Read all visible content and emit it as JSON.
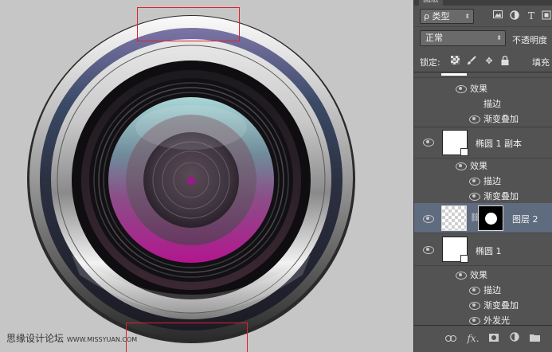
{
  "panel": {
    "tab_label": "图层",
    "filter_label": "ρ 类型",
    "filter_icons": [
      "image-filter-icon",
      "adjustment-filter-icon",
      "type-filter-icon",
      "shape-filter-icon"
    ],
    "type_glyph": "T",
    "blend_mode": "正常",
    "opacity_label": "不透明度",
    "lock_label": "锁定:",
    "fill_label": "填充",
    "lock_icons": [
      "lock-transparent-icon",
      "lock-paint-icon",
      "lock-move-icon",
      "lock-all-icon"
    ]
  },
  "layers": [
    {
      "kind": "effects-head",
      "label": "效果"
    },
    {
      "kind": "effect",
      "label": "描边",
      "visible": false
    },
    {
      "kind": "effect",
      "label": "渐变叠加",
      "visible": true
    },
    {
      "kind": "layer",
      "name": "椭圆 1 副本",
      "selected": false
    },
    {
      "kind": "effects-head",
      "label": "效果"
    },
    {
      "kind": "effect",
      "label": "描边",
      "visible": true
    },
    {
      "kind": "effect",
      "label": "渐变叠加",
      "visible": true
    },
    {
      "kind": "layer-mask",
      "name": "图层 2",
      "selected": true
    },
    {
      "kind": "layer",
      "name": "椭圆 1",
      "selected": false
    },
    {
      "kind": "effects-head",
      "label": "效果"
    },
    {
      "kind": "effect",
      "label": "描边",
      "visible": true
    },
    {
      "kind": "effect",
      "label": "渐变叠加",
      "visible": true
    },
    {
      "kind": "effect",
      "label": "外发光",
      "visible": true
    }
  ],
  "footer": {
    "fx_label": "fx.",
    "icons": [
      "link-icon",
      "fx-icon",
      "add-mask-icon",
      "adjustment-layer-icon",
      "folder-icon"
    ]
  },
  "watermark": {
    "text": "思缘设计论坛",
    "url": "WWW.MISSYUAN.COM"
  },
  "colors": {
    "canvas_bg": "#c6c6c6",
    "panel_bg": "#535353",
    "selected_row": "#5f6b7f",
    "selection_rect": "#e0202a",
    "lens_magenta": "#9a1a78",
    "lens_teal": "#9ec7c9"
  }
}
